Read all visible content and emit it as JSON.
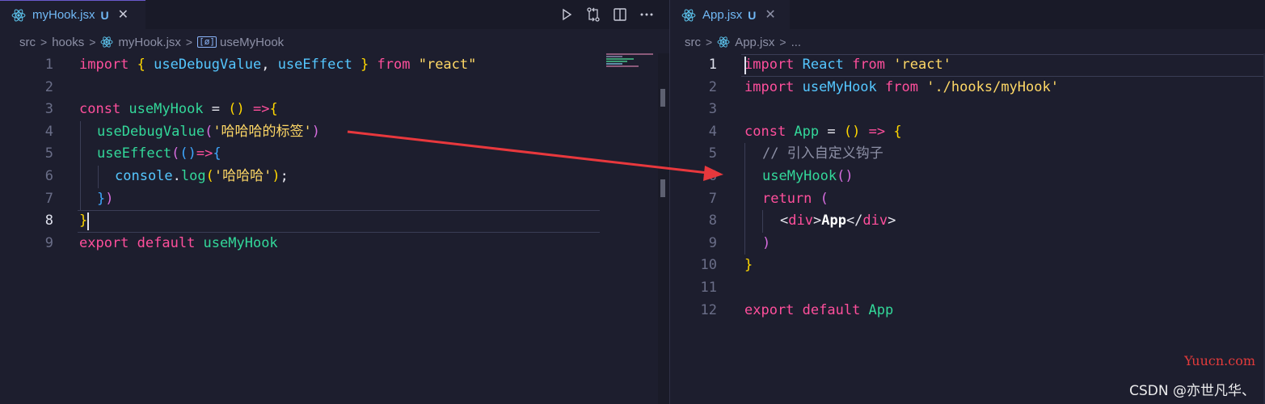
{
  "left": {
    "tab": {
      "name": "myHook.jsx",
      "status": "U"
    },
    "breadcrumb": [
      "src",
      "hooks",
      "myHook.jsx",
      "useMyHook"
    ],
    "lines": [
      {
        "n": "1",
        "tokens": [
          [
            "kw",
            "import "
          ],
          [
            "br1",
            "{ "
          ],
          [
            "var",
            "useDebugValue"
          ],
          [
            "",
            ","
          ],
          [
            "var",
            " useEffect"
          ],
          [
            "br1",
            " } "
          ],
          [
            "kw",
            "from "
          ],
          [
            "str",
            "\"react\""
          ]
        ]
      },
      {
        "n": "2",
        "tokens": []
      },
      {
        "n": "3",
        "tokens": [
          [
            "kw",
            "const "
          ],
          [
            "fn",
            "useMyHook"
          ],
          [
            "",
            " = "
          ],
          [
            "br1",
            "()"
          ],
          [
            "",
            " "
          ],
          [
            "kw",
            "=>"
          ],
          [
            "br1",
            "{"
          ]
        ]
      },
      {
        "n": "4",
        "tokens": [
          [
            "",
            ""
          ],
          [
            "fn",
            "useDebugValue"
          ],
          [
            "br2",
            "("
          ],
          [
            "str",
            "'哈哈哈的标签'"
          ],
          [
            "br2",
            ")"
          ]
        ]
      },
      {
        "n": "5",
        "tokens": [
          [
            "fn",
            "useEffect"
          ],
          [
            "br2",
            "("
          ],
          [
            "br3",
            "()"
          ],
          [
            "kw",
            "=>"
          ],
          [
            "br3",
            "{"
          ]
        ]
      },
      {
        "n": "6",
        "tokens": [
          [
            "var",
            "console"
          ],
          [
            "",
            "."
          ],
          [
            "fn",
            "log"
          ],
          [
            "br1",
            "("
          ],
          [
            "str",
            "'哈哈哈'"
          ],
          [
            "br1",
            ")"
          ],
          [
            "",
            ";"
          ]
        ]
      },
      {
        "n": "7",
        "tokens": [
          [
            "br3",
            "}"
          ],
          [
            "br2",
            ")"
          ]
        ]
      },
      {
        "n": "8",
        "tokens": [
          [
            "br1",
            "}"
          ]
        ]
      },
      {
        "n": "9",
        "tokens": [
          [
            "kw",
            "export "
          ],
          [
            "kw",
            "default "
          ],
          [
            "fn",
            "useMyHook"
          ]
        ]
      }
    ]
  },
  "right": {
    "tab": {
      "name": "App.jsx",
      "status": "U"
    },
    "breadcrumb": [
      "src",
      "App.jsx",
      "..."
    ],
    "lines": [
      {
        "n": "1",
        "tokens": [
          [
            "kw",
            "import "
          ],
          [
            "var",
            "React "
          ],
          [
            "kw",
            "from "
          ],
          [
            "str",
            "'react'"
          ]
        ]
      },
      {
        "n": "2",
        "tokens": [
          [
            "kw",
            "import "
          ],
          [
            "var",
            "useMyHook "
          ],
          [
            "kw",
            "from "
          ],
          [
            "str",
            "'./hooks/myHook'"
          ]
        ]
      },
      {
        "n": "3",
        "tokens": []
      },
      {
        "n": "4",
        "tokens": [
          [
            "kw",
            "const "
          ],
          [
            "fn",
            "App"
          ],
          [
            "",
            " = "
          ],
          [
            "br1",
            "()"
          ],
          [
            "",
            " "
          ],
          [
            "kw",
            "=>"
          ],
          [
            "",
            " "
          ],
          [
            "br1",
            "{"
          ]
        ]
      },
      {
        "n": "5",
        "tokens": [
          [
            "cm",
            "// 引入自定义钩子"
          ]
        ]
      },
      {
        "n": "6",
        "tokens": [
          [
            "fn",
            "useMyHook"
          ],
          [
            "br2",
            "()"
          ]
        ]
      },
      {
        "n": "7",
        "tokens": [
          [
            "kw",
            "return "
          ],
          [
            "br2",
            "("
          ]
        ]
      },
      {
        "n": "8",
        "tokens": [
          [
            "",
            "<"
          ],
          [
            "tag",
            "div"
          ],
          [
            "",
            ">"
          ],
          [
            "txt",
            "App"
          ],
          [
            "",
            "</"
          ],
          [
            "tag",
            "div"
          ],
          [
            "",
            ">"
          ]
        ]
      },
      {
        "n": "9",
        "tokens": [
          [
            "br2",
            ")"
          ]
        ]
      },
      {
        "n": "10",
        "tokens": [
          [
            "br1",
            "}"
          ]
        ]
      },
      {
        "n": "11",
        "tokens": []
      },
      {
        "n": "12",
        "tokens": [
          [
            "kw",
            "export "
          ],
          [
            "kw",
            "default "
          ],
          [
            "fn",
            "App"
          ]
        ]
      }
    ]
  },
  "watermark": {
    "site": "Yuucn.com",
    "author": "CSDN @亦世凡华、"
  },
  "colors": {
    "accent": "#ff4f9c",
    "arrow": "#e8383d",
    "react": "#5ec8f2"
  }
}
